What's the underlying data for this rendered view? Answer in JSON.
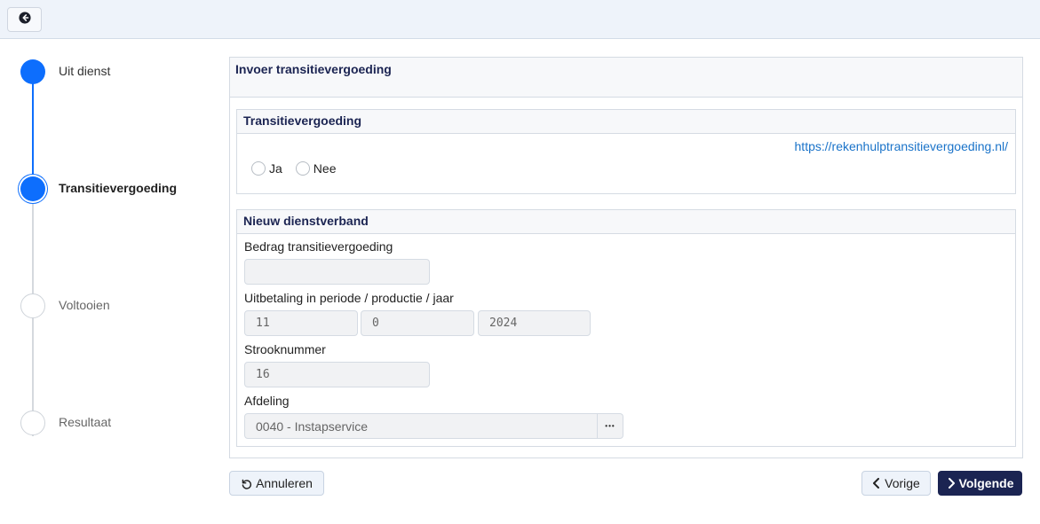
{
  "topbar": {
    "back_icon": "arrow-left-circle-icon"
  },
  "stepper": {
    "steps": [
      {
        "label": "Uit dienst",
        "state": "done"
      },
      {
        "label": "Transitievergoeding",
        "state": "active"
      },
      {
        "label": "Voltooien",
        "state": "todo"
      },
      {
        "label": "Resultaat",
        "state": "todo"
      }
    ]
  },
  "panel": {
    "title": "Invoer transitievergoeding"
  },
  "transition_card": {
    "title": "Transitievergoeding",
    "link": "https://rekenhulptransitievergoeding.nl/",
    "options": [
      "Ja",
      "Nee"
    ]
  },
  "employment_card": {
    "title": "Nieuw dienstverband",
    "amount_label": "Bedrag transitievergoeding",
    "amount_value": "",
    "payout_label": "Uitbetaling in periode / productie / jaar",
    "period": "11",
    "production": "0",
    "year": "2024",
    "strip_label": "Strooknummer",
    "strip_value": "16",
    "dept_label": "Afdeling",
    "dept_value": "0040 - Instapservice",
    "dept_button": "•••"
  },
  "actions": {
    "cancel": "Annuleren",
    "previous": "Vorige",
    "next": "Volgende"
  },
  "colors": {
    "primary": "#0d6efd",
    "navy": "#1b2452",
    "link": "#1a73c9"
  }
}
